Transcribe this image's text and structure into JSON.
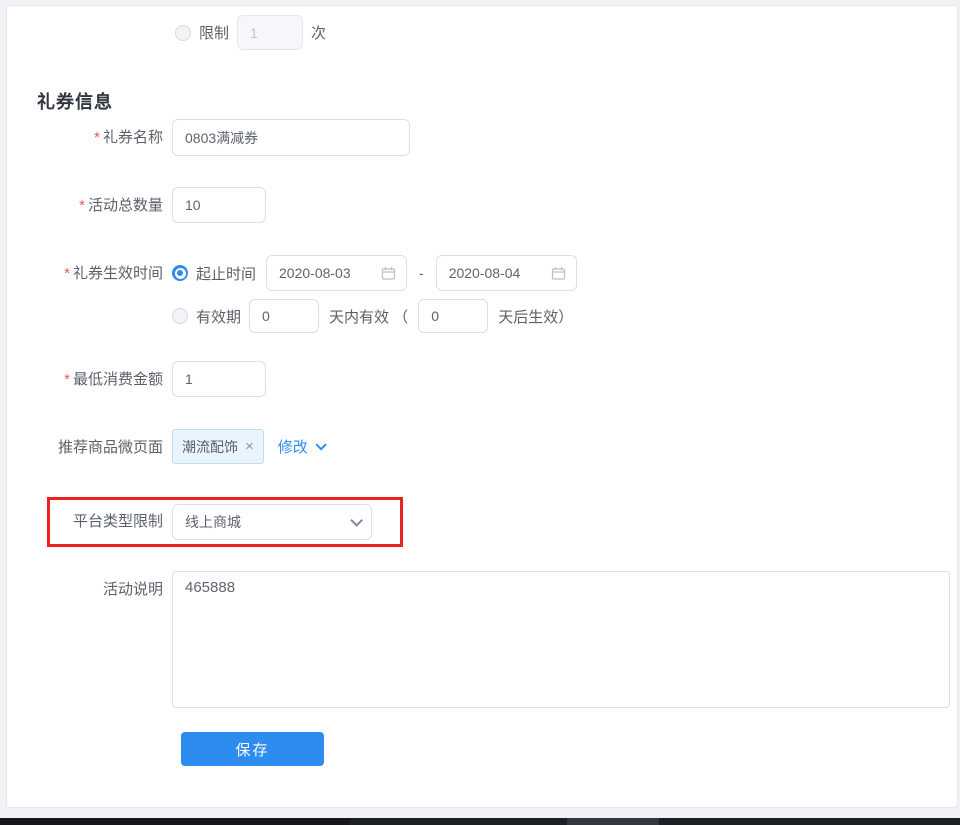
{
  "required_mark": "*",
  "section_title": "礼券信息",
  "limit_row": {
    "radio_label": "限制",
    "value": "1",
    "suffix": "次"
  },
  "form": {
    "name": {
      "label": "礼券名称",
      "value": "0803满减券"
    },
    "quantity": {
      "label": "活动总数量",
      "value": "10"
    },
    "effective_time": {
      "label": "礼券生效时间",
      "range_radio_label": "起止时间",
      "start_date": "2020-08-03",
      "range_separator": "-",
      "end_date": "2020-08-04",
      "validity_radio_label": "有效期",
      "valid_days_value": "0",
      "valid_days_text": "天内有效 （",
      "delay_days_value": "0",
      "delay_days_text": "天后生效）"
    },
    "min_amount": {
      "label": "最低消费金额",
      "value": "1"
    },
    "micro_page": {
      "label": "推荐商品微页面",
      "tag_text": "潮流配饰",
      "tag_close": "×",
      "modify_link": "修改"
    },
    "platform": {
      "label": "平台类型限制",
      "value": "线上商城"
    },
    "description": {
      "label": "活动说明",
      "value": "465888"
    }
  },
  "save_button_label": "保存",
  "colors": {
    "primary": "#2d8cf0",
    "annotation_red": "#ee2121",
    "tag_background": "#e9f4fd",
    "tag_border": "#bfddf8"
  }
}
